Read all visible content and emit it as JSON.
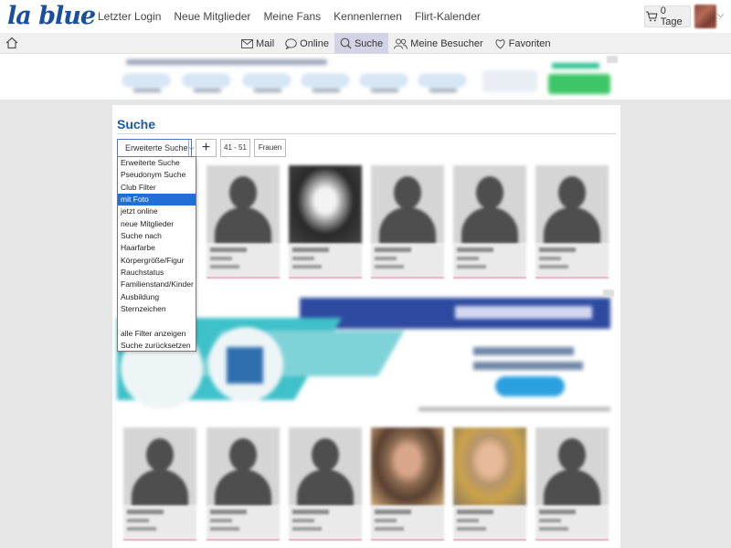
{
  "header": {
    "logo": "la blue",
    "nav": [
      "Letzter Login",
      "Neue Mitglieder",
      "Meine Fans",
      "Kennenlernen",
      "Flirt-Kalender"
    ],
    "days_badge": "0 Tage"
  },
  "subnav": {
    "items": [
      {
        "label": "Mail",
        "icon": "mail-icon"
      },
      {
        "label": "Online",
        "icon": "chat-bubble-icon"
      },
      {
        "label": "Suche",
        "icon": "search-icon",
        "active": true
      },
      {
        "label": "Meine Besucher",
        "icon": "visitors-icon"
      },
      {
        "label": "Favoriten",
        "icon": "heart-icon"
      }
    ]
  },
  "search": {
    "title": "Suche",
    "select_value": "Erweiterte Suche",
    "plus_label": "+",
    "age_range": "41 - 51",
    "gender": "Frauen",
    "dropdown_options": [
      {
        "label": "Erweiterte Suche"
      },
      {
        "label": "Pseudonym Suche"
      },
      {
        "label": "Club Filter"
      },
      {
        "label": "mit Foto",
        "selected": true
      },
      {
        "label": "jetzt online"
      },
      {
        "label": "neue Mitglieder"
      },
      {
        "label": "Suche nach"
      },
      {
        "label": "Haarfarbe"
      },
      {
        "label": "Körpergröße/Figur"
      },
      {
        "label": "Rauchstatus"
      },
      {
        "label": "Familienstand/Kinder"
      },
      {
        "label": "Ausbildung"
      },
      {
        "label": "Sternzeichen"
      },
      {
        "label": ""
      },
      {
        "label": "alle Filter anzeigen"
      },
      {
        "label": "Suche zurücksetzen"
      }
    ]
  },
  "midad": {
    "headline": "AUF ALLES 50%"
  },
  "colors": {
    "brand": "#1a4fa0",
    "title": "#1c58a6",
    "selected_option": "#1f6fd6",
    "active_tab": "#d3d3e6"
  }
}
